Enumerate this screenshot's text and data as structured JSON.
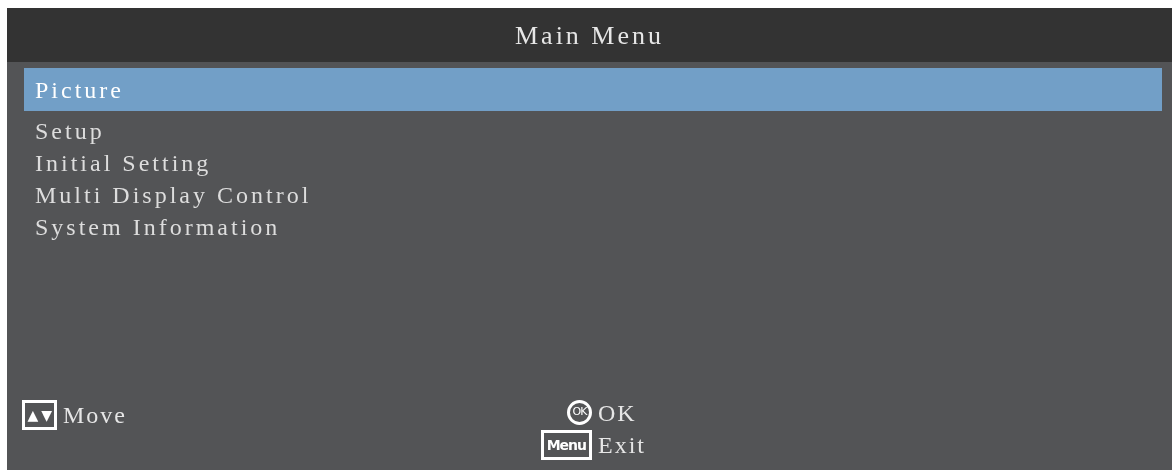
{
  "title": "Main Menu",
  "menu": [
    {
      "label": "Picture",
      "selected": true
    },
    {
      "label": "Setup",
      "selected": false
    },
    {
      "label": "Initial Setting",
      "selected": false
    },
    {
      "label": "Multi Display Control",
      "selected": false
    },
    {
      "label": "System Information",
      "selected": false
    }
  ],
  "hints": [
    {
      "key": "▲ ▼",
      "label": "Move",
      "kind": "box"
    },
    {
      "key": "OK",
      "label": "OK",
      "kind": "circle"
    },
    {
      "key": "Menu",
      "label": "Exit",
      "kind": "box"
    }
  ]
}
